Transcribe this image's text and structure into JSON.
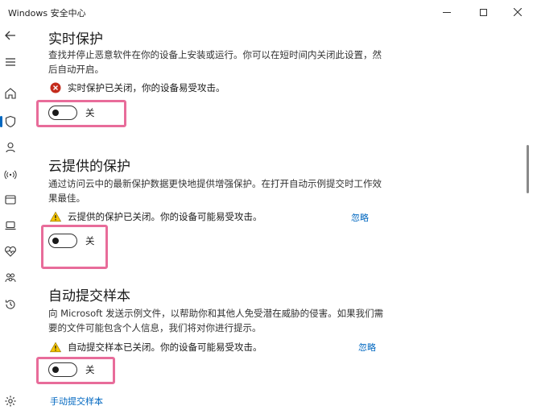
{
  "window": {
    "title": "Windows 安全中心"
  },
  "nav": {
    "items": [
      "back-icon",
      "menu-icon",
      "home-icon",
      "shield-icon",
      "person-icon",
      "wifi-icon",
      "app-icon",
      "laptop-icon",
      "health-icon",
      "family-icon",
      "history-icon",
      "settings-icon"
    ]
  },
  "realtime": {
    "title": "实时保护",
    "description": "查找并停止恶意软件在你的设备上安装或运行。你可以在短时间内关闭此设置，然后自动开启。",
    "status": "实时保护已关闭，你的设备易受攻击。",
    "status_color": "#c42b1c",
    "toggle_label": "关",
    "toggle_on": false
  },
  "cloud": {
    "title": "云提供的保护",
    "description": "通过访问云中的最新保护数据更快地提供增强保护。在打开自动示例提交时工作效果最佳。",
    "status": "云提供的保护已关闭。你的设备可能易受攻击。",
    "dismiss": "忽略",
    "toggle_label": "关",
    "toggle_on": false
  },
  "sample": {
    "title": "自动提交样本",
    "description": "向 Microsoft 发送示例文件，以帮助你和其他人免受潜在威胁的侵害。如果我们需要的文件可能包含个人信息，我们将对你进行提示。",
    "status": "自动提交样本已关闭。你的设备可能易受攻击。",
    "dismiss": "忽略",
    "toggle_label": "关",
    "toggle_on": false,
    "manual_link": "手动提交样本"
  },
  "colors": {
    "accent": "#0067c0",
    "highlight": "#e86c9a",
    "warning": "#f5c400"
  }
}
